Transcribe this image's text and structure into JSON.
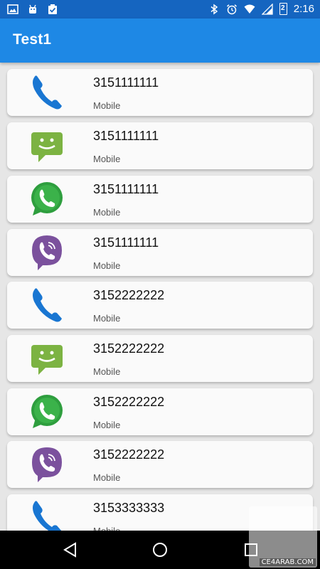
{
  "status_bar": {
    "time": "2:16",
    "battery_level": "2",
    "left_icons": [
      "gallery-icon",
      "android-icon",
      "clipboard-check-icon"
    ],
    "right_icons": [
      "bluetooth-icon",
      "alarm-icon",
      "wifi-icon",
      "signal-icon",
      "battery-icon"
    ]
  },
  "app_bar": {
    "title": "Test1"
  },
  "contacts": [
    {
      "number": "3151111111",
      "type": "Mobile",
      "icon": "phone-icon"
    },
    {
      "number": "3151111111",
      "type": "Mobile",
      "icon": "sms-icon"
    },
    {
      "number": "3151111111",
      "type": "Mobile",
      "icon": "whatsapp-icon"
    },
    {
      "number": "3151111111",
      "type": "Mobile",
      "icon": "viber-icon"
    },
    {
      "number": "3152222222",
      "type": "Mobile",
      "icon": "phone-icon"
    },
    {
      "number": "3152222222",
      "type": "Mobile",
      "icon": "sms-icon"
    },
    {
      "number": "3152222222",
      "type": "Mobile",
      "icon": "whatsapp-icon"
    },
    {
      "number": "3152222222",
      "type": "Mobile",
      "icon": "viber-icon"
    },
    {
      "number": "3153333333",
      "type": "Mobile",
      "icon": "phone-icon"
    }
  ],
  "nav_bar": {
    "buttons": [
      "back-icon",
      "home-icon",
      "recents-icon"
    ]
  },
  "watermark": {
    "text": "CE4ARAB.COM"
  },
  "colors": {
    "status_bar": "#1565c0",
    "app_bar": "#1e88e5",
    "background": "#e6e6e6",
    "card": "#fafafa"
  }
}
